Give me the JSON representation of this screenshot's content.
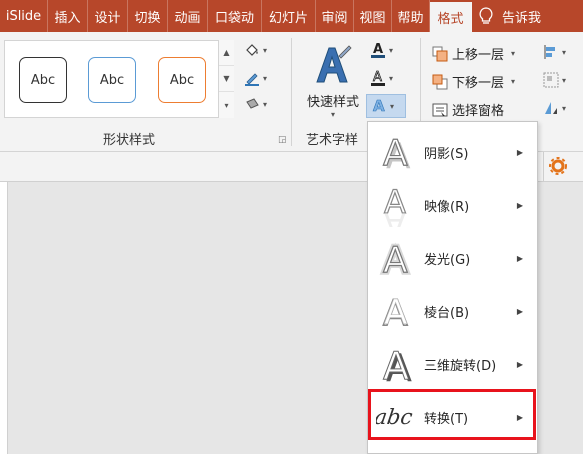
{
  "tabs": [
    {
      "label": "iSlide",
      "active": false
    },
    {
      "label": "插入",
      "active": false
    },
    {
      "label": "设计",
      "active": false
    },
    {
      "label": "切换",
      "active": false
    },
    {
      "label": "动画",
      "active": false
    },
    {
      "label": "口袋动",
      "active": false
    },
    {
      "label": "幻灯片",
      "active": false
    },
    {
      "label": "审阅",
      "active": false
    },
    {
      "label": "视图",
      "active": false
    },
    {
      "label": "帮助",
      "active": false
    },
    {
      "label": "格式",
      "active": true
    }
  ],
  "tell_me": "告诉我",
  "shape_styles": {
    "gallery": [
      {
        "label": "Abc",
        "border_color": "#333333"
      },
      {
        "label": "Abc",
        "border_color": "#5b9bd5"
      },
      {
        "label": "Abc",
        "border_color": "#ed7d31"
      }
    ],
    "group_label": "形状样式"
  },
  "wordart": {
    "quick_styles_label": "快速样式",
    "group_label": "艺术字样"
  },
  "arrange": {
    "bring_forward": "上移一层",
    "send_backward": "下移一层",
    "selection_pane": "选择窗格"
  },
  "text_effects_menu": [
    {
      "label": "阴影(S)",
      "icon": "shadow-a-icon"
    },
    {
      "label": "映像(R)",
      "icon": "reflection-a-icon"
    },
    {
      "label": "发光(G)",
      "icon": "glow-a-icon"
    },
    {
      "label": "棱台(B)",
      "icon": "bevel-a-icon"
    },
    {
      "label": "三维旋转(D)",
      "icon": "3d-rotation-a-icon"
    },
    {
      "label": "转换(T)",
      "icon": "transform-abc-icon"
    }
  ],
  "colors": {
    "accent": "#b7472a",
    "highlight": "#e8131c",
    "text_fill": "#1f4e79"
  }
}
